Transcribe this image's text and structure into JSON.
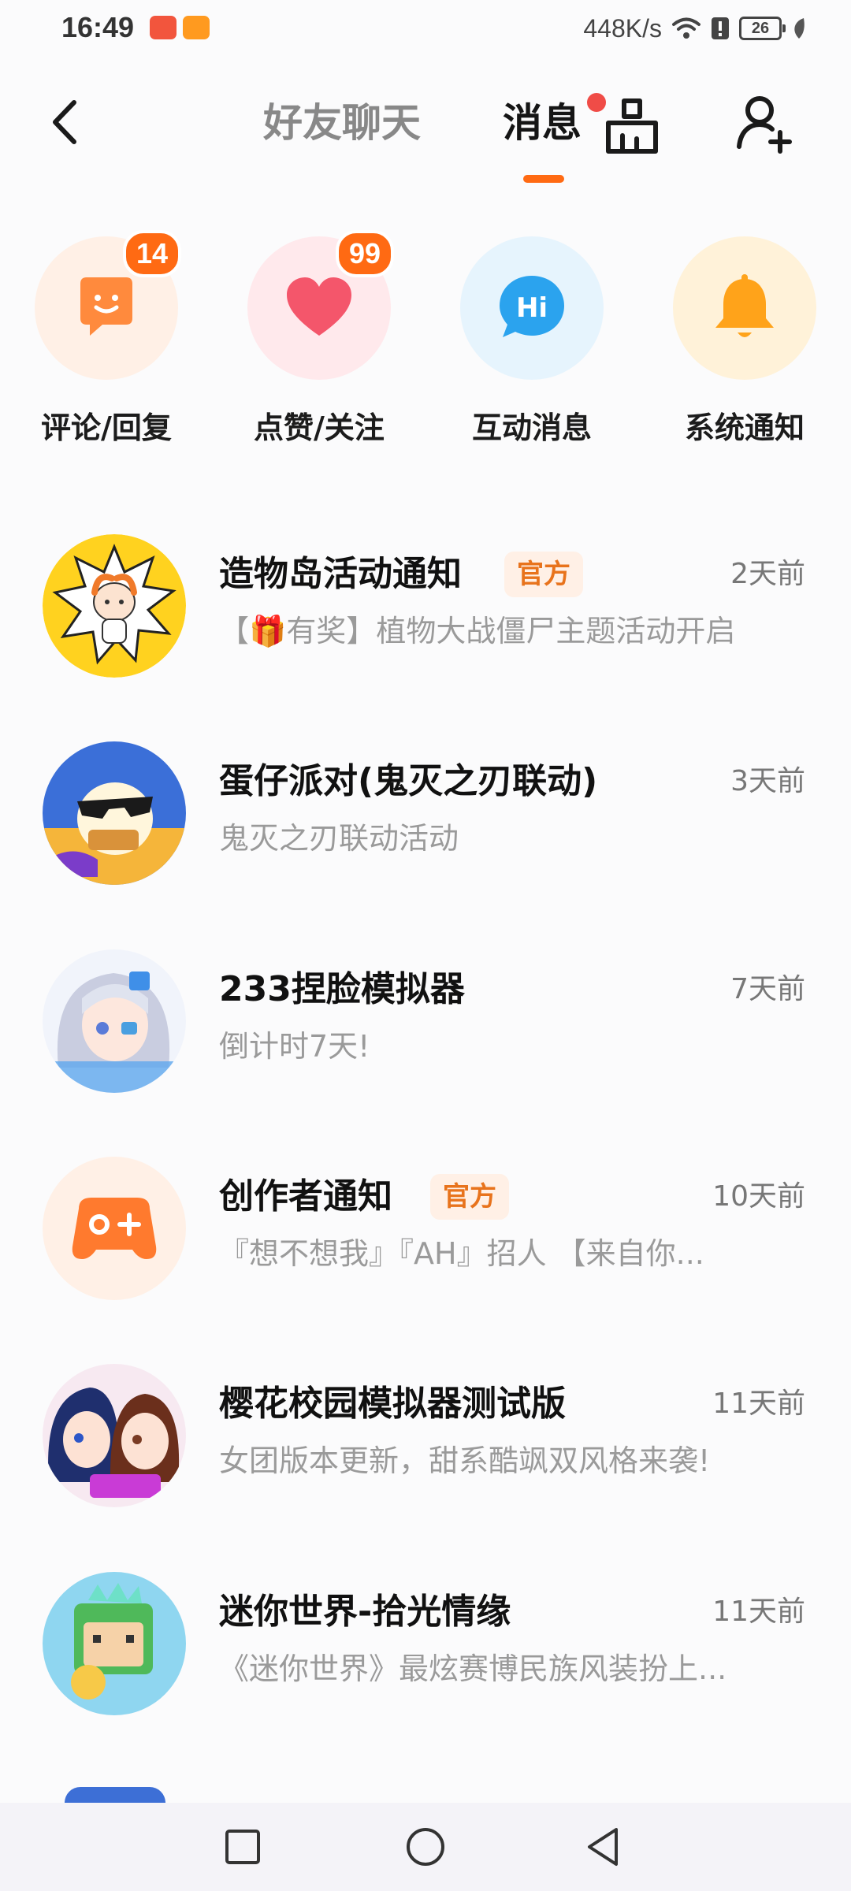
{
  "status_bar": {
    "time": "16:49",
    "speed": "448K/s",
    "battery": "26",
    "icons": [
      "app-notification-icon",
      "video-app-icon",
      "wifi-icon",
      "alert-icon",
      "battery-icon",
      "leaf-icon"
    ]
  },
  "header": {
    "tabs": [
      {
        "label": "好友聊天",
        "active": false
      },
      {
        "label": "消息",
        "active": true,
        "has_dot": true
      }
    ],
    "accent_color": "#ff6a13",
    "icons": [
      "back-icon",
      "broom-icon",
      "add-friend-icon"
    ]
  },
  "categories": [
    {
      "label": "评论/回复",
      "badge": "14",
      "icon": "comment-icon",
      "bg": "#fff0e6",
      "color": "#ff8a3d"
    },
    {
      "label": "点赞/关注",
      "badge": "99",
      "icon": "heart-icon",
      "bg": "#ffe9ec",
      "color": "#f4566b"
    },
    {
      "label": "互动消息",
      "badge": "",
      "icon": "hi-icon",
      "bg": "#e6f4fd",
      "color": "#2ba3ee"
    },
    {
      "label": "系统通知",
      "badge": "",
      "icon": "bell-icon",
      "bg": "#fff2d9",
      "color": "#ffa31a"
    }
  ],
  "messages": [
    {
      "title": "造物岛活动通知",
      "official": "官方",
      "time": "2天前",
      "preview": "【🎁有奖】植物大战僵尸主题活动开启"
    },
    {
      "title": "蛋仔派对(鬼灭之刃联动)",
      "official": "",
      "time": "3天前",
      "preview": "鬼灭之刃联动活动"
    },
    {
      "title": "233捏脸模拟器",
      "official": "",
      "time": "7天前",
      "preview": "倒计时7天!"
    },
    {
      "title": "创作者通知",
      "official": "官方",
      "time": "10天前",
      "preview": "『想不想我』『AH』招人 【来自你..."
    },
    {
      "title": "樱花校园模拟器测试版",
      "official": "",
      "time": "11天前",
      "preview": "女团版本更新，甜系酷飒双风格来袭!"
    },
    {
      "title": "迷你世界-拾光情缘",
      "official": "",
      "time": "11天前",
      "preview": "《迷你世界》最炫赛博民族风装扮上..."
    }
  ],
  "nav_bar": {
    "buttons": [
      "recents-icon",
      "home-icon",
      "back-nav-icon"
    ]
  }
}
